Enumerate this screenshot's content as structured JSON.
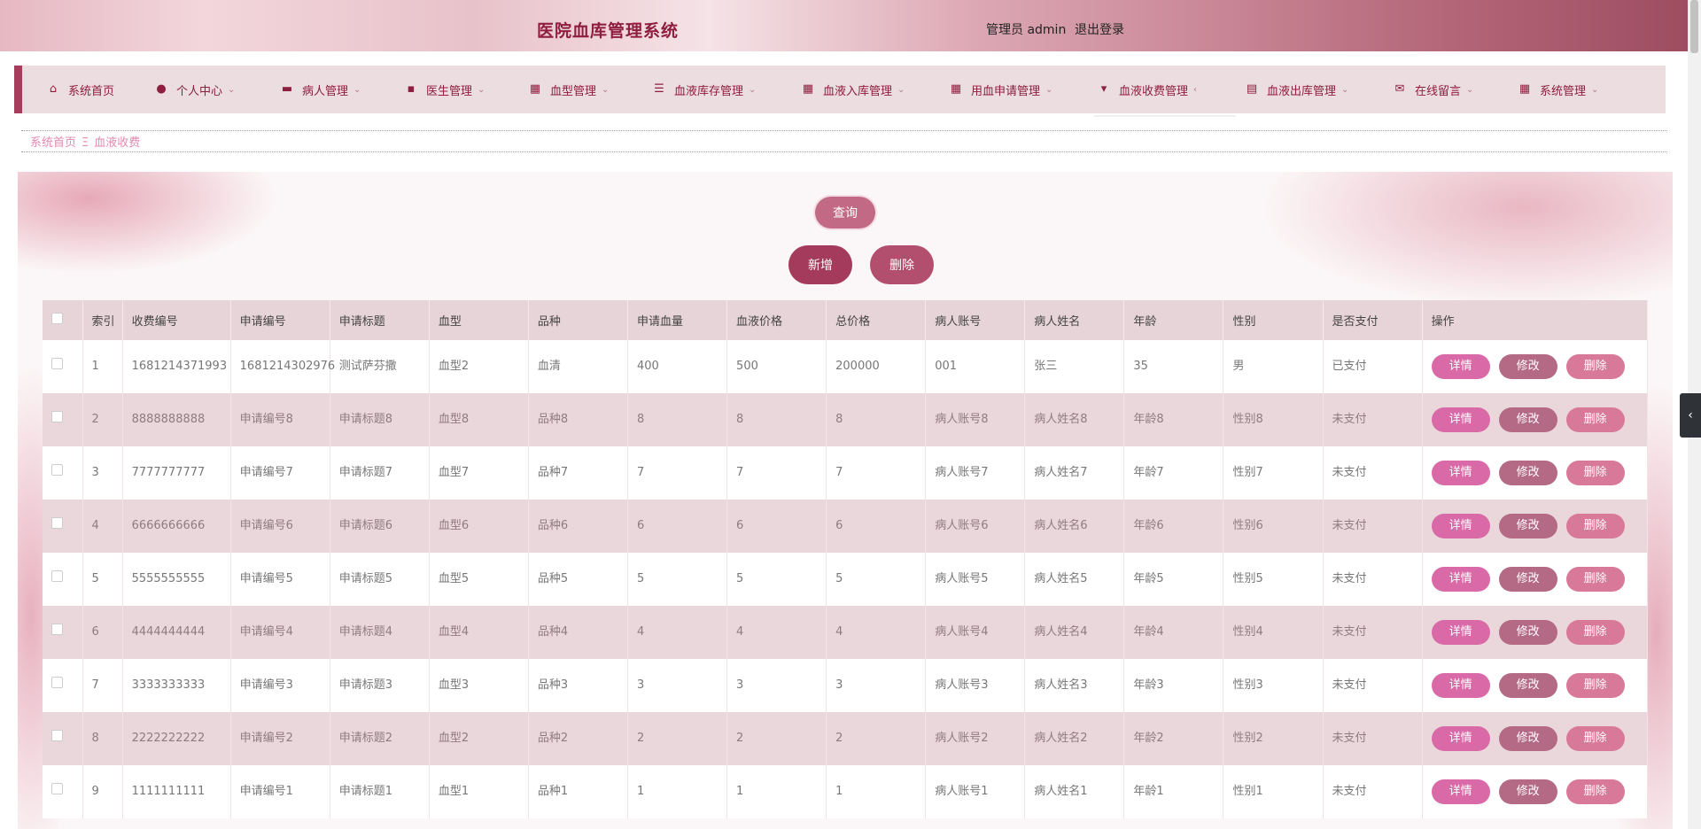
{
  "header": {
    "title": "医院血库管理系统",
    "user": "管理员 admin",
    "logout": "退出登录"
  },
  "nav": {
    "items": [
      {
        "label": "系统首页",
        "icon": "home-icon"
      },
      {
        "label": "个人中心",
        "icon": "user-icon"
      },
      {
        "label": "病人管理",
        "icon": "bed-icon"
      },
      {
        "label": "医生管理",
        "icon": "chat-icon"
      },
      {
        "label": "血型管理",
        "icon": "grid-icon"
      },
      {
        "label": "血液库存管理",
        "icon": "list-icon"
      },
      {
        "label": "血液入库管理",
        "icon": "grid-icon"
      },
      {
        "label": "用血申请管理",
        "icon": "grid-icon"
      },
      {
        "label": "血液收费管理",
        "icon": "cup-icon"
      },
      {
        "label": "血液出库管理",
        "icon": "clipboard-icon"
      },
      {
        "label": "在线留言",
        "icon": "message-icon"
      },
      {
        "label": "系统管理",
        "icon": "grid-icon"
      }
    ]
  },
  "breadcrumb": {
    "home": "系统首页",
    "current": "血液收费"
  },
  "toolbar": {
    "query": "查询",
    "add": "新增",
    "delete": "删除"
  },
  "table": {
    "columns": [
      "索引",
      "收费编号",
      "申请编号",
      "申请标题",
      "血型",
      "品种",
      "申请血量",
      "血液价格",
      "总价格",
      "病人账号",
      "病人姓名",
      "年龄",
      "性别",
      "是否支付",
      "操作"
    ],
    "rows": [
      [
        "1",
        "1681214371993",
        "1681214302976",
        "测试萨芬撒",
        "血型2",
        "血清",
        "400",
        "500",
        "200000",
        "001",
        "张三",
        "35",
        "男",
        "已支付"
      ],
      [
        "2",
        "8888888888",
        "申请编号8",
        "申请标题8",
        "血型8",
        "品种8",
        "8",
        "8",
        "8",
        "病人账号8",
        "病人姓名8",
        "年龄8",
        "性别8",
        "未支付"
      ],
      [
        "3",
        "7777777777",
        "申请编号7",
        "申请标题7",
        "血型7",
        "品种7",
        "7",
        "7",
        "7",
        "病人账号7",
        "病人姓名7",
        "年龄7",
        "性别7",
        "未支付"
      ],
      [
        "4",
        "6666666666",
        "申请编号6",
        "申请标题6",
        "血型6",
        "品种6",
        "6",
        "6",
        "6",
        "病人账号6",
        "病人姓名6",
        "年龄6",
        "性别6",
        "未支付"
      ],
      [
        "5",
        "5555555555",
        "申请编号5",
        "申请标题5",
        "血型5",
        "品种5",
        "5",
        "5",
        "5",
        "病人账号5",
        "病人姓名5",
        "年龄5",
        "性别5",
        "未支付"
      ],
      [
        "6",
        "4444444444",
        "申请编号4",
        "申请标题4",
        "血型4",
        "品种4",
        "4",
        "4",
        "4",
        "病人账号4",
        "病人姓名4",
        "年龄4",
        "性别4",
        "未支付"
      ],
      [
        "7",
        "3333333333",
        "申请编号3",
        "申请标题3",
        "血型3",
        "品种3",
        "3",
        "3",
        "3",
        "病人账号3",
        "病人姓名3",
        "年龄3",
        "性别3",
        "未支付"
      ],
      [
        "8",
        "2222222222",
        "申请编号2",
        "申请标题2",
        "血型2",
        "品种2",
        "2",
        "2",
        "2",
        "病人账号2",
        "病人姓名2",
        "年龄2",
        "性别2",
        "未支付"
      ],
      [
        "9",
        "1111111111",
        "申请编号1",
        "申请标题1",
        "血型1",
        "品种1",
        "1",
        "1",
        "1",
        "病人账号1",
        "病人姓名1",
        "年龄1",
        "性别1",
        "未支付"
      ]
    ],
    "row_actions": {
      "detail": "详情",
      "edit": "修改",
      "delete": "删除"
    }
  },
  "colors": {
    "brand": "#8e1d3f",
    "nav_bg": "#ecdde0",
    "row_alt": "#ead7db",
    "detail_btn": "#d96aa7",
    "edit_btn": "#b46a84",
    "delete_btn": "#d9799a"
  }
}
